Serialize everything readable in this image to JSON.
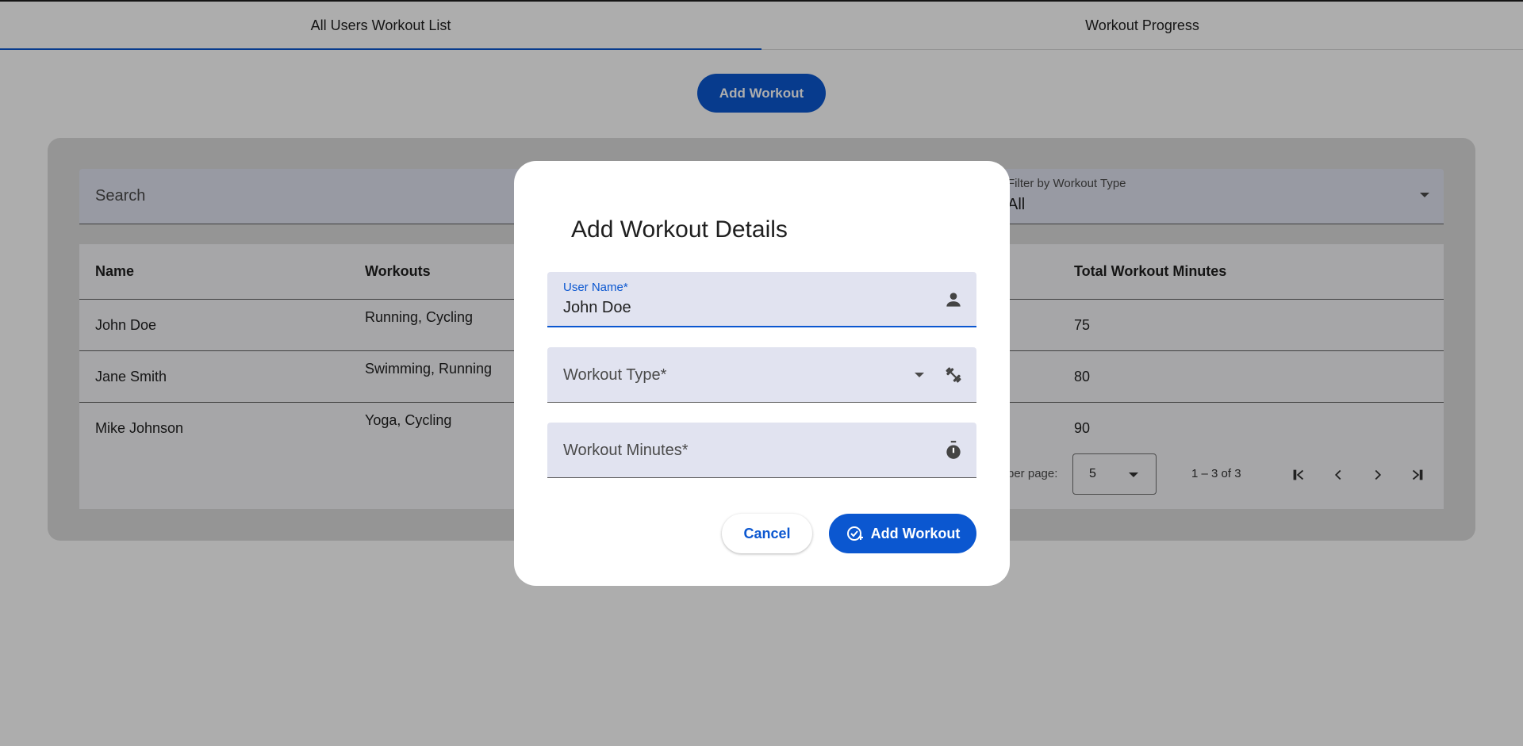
{
  "tabs": [
    {
      "label": "All Users Workout List",
      "active": true
    },
    {
      "label": "Workout Progress",
      "active": false
    }
  ],
  "page": {
    "add_button": "Add Workout"
  },
  "search": {
    "placeholder": "Search"
  },
  "filter": {
    "label": "Filter by Workout Type",
    "value": "All"
  },
  "table": {
    "headers": {
      "name": "Name",
      "workouts": "Workouts",
      "total": "Total Workout Minutes"
    },
    "rows": [
      {
        "name": "John Doe",
        "workouts": "Running, Cycling",
        "total": "75"
      },
      {
        "name": "Jane Smith",
        "workouts": "Swimming, Running",
        "total": "80"
      },
      {
        "name": "Mike Johnson",
        "workouts": "Yoga, Cycling",
        "total": "90"
      }
    ]
  },
  "paginator": {
    "items_per_page_label": "per page:",
    "page_size": "5",
    "range": "1 – 3 of 3"
  },
  "dialog": {
    "title": "Add Workout Details",
    "user_name": {
      "label": "User Name*",
      "value": "John Doe",
      "icon": "person-icon"
    },
    "workout_type": {
      "placeholder": "Workout Type*",
      "icon": "dumbbell-icon"
    },
    "workout_minutes": {
      "placeholder": "Workout Minutes*",
      "icon": "timer-icon"
    },
    "cancel_label": "Cancel",
    "submit_label": "Add Workout",
    "submit_icon": "add-task-icon"
  },
  "colors": {
    "primary": "#0b57d0",
    "field_bg": "#e1e3f0",
    "scrim": "rgba(0,0,0,0.32)"
  }
}
